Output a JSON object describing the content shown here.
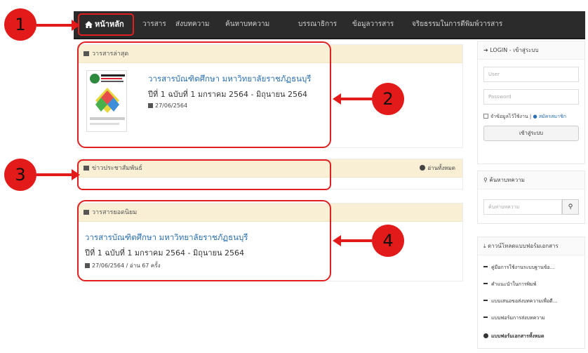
{
  "colors": {
    "navbar": "#2b2b2b",
    "panel_head": "#f8efd4",
    "link": "#2a6fb0",
    "callout": "#e21a1a"
  },
  "navbar": {
    "items": [
      {
        "label": "หน้าหลัก",
        "icon": "home-icon"
      },
      {
        "label": "วารสาร"
      },
      {
        "label": "ส่งบทความ"
      },
      {
        "label": "ค้นหาบทความ"
      },
      {
        "label": "บรรณาธิการ"
      },
      {
        "label": "ข้อมูลวารสาร"
      },
      {
        "label": "จริยธรรมในการตีพิมพ์วารสาร"
      }
    ]
  },
  "latest": {
    "heading": "วารสารล่าสุด",
    "title": "วารสารบัณฑิตศึกษา มหาวิทยาลัยราชภัฏธนบุรี",
    "issue": "ปีที่ 1 ฉบับที่ 1 มกราคม 2564 - มิถุนายน 2564",
    "date": "27/06/2564"
  },
  "news": {
    "heading": "ข่าวประชาสัมพันธ์",
    "read_all": "อ่านทั้งหมด"
  },
  "popular": {
    "heading": "วารสารยอดนิยม",
    "title": "วารสารบัณฑิตศึกษา มหาวิทยาลัยราชภัฏธนบุรี",
    "issue": "ปีที่ 1 ฉบับที่ 1 มกราคม 2564 - มิถุนายน 2564",
    "meta": "27/06/2564 / อ่าน 67 ครั้ง"
  },
  "login": {
    "heading": "LOGIN - เข้าสู่ระบบ",
    "user_placeholder": "User",
    "password_placeholder": "Password",
    "remember": "จำข้อมูลไว้ใช้งาน",
    "register": "สมัครสมาชิก",
    "submit": "เข้าสู่ระบบ"
  },
  "search": {
    "heading": "ค้นหาบทความ",
    "placeholder": "ค้นหาบทความ"
  },
  "downloads": {
    "heading": "ดาวน์โหลดแบบฟอร์มเอกสาร",
    "items": [
      "คู่มือการใช้งานระบบฐานข้อ...",
      "คำแนะนำในการพิมพ์",
      "แบบเสนอขอส่งบทความเพื่อตี...",
      "แบบฟอร์มการส่งบทความ"
    ],
    "all": "แบบฟอร์มเอกสารทั้งหมด"
  },
  "callouts": [
    "1",
    "2",
    "3",
    "4"
  ]
}
